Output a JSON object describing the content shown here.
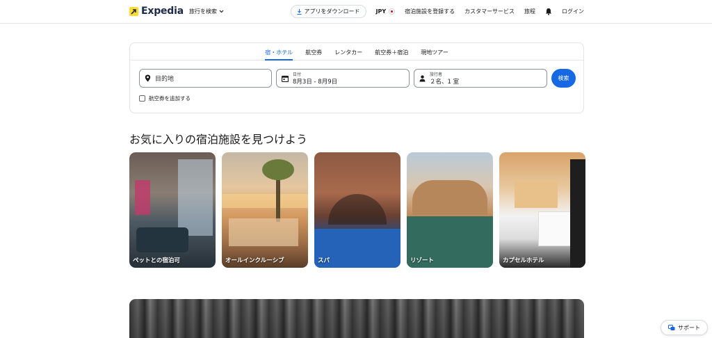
{
  "header": {
    "logo_text": "Expedia",
    "trip_search": "旅行を検索",
    "app_download": "アプリをダウンロード",
    "currency": "JPY",
    "list_property": "宿泊施設を登録する",
    "customer_service": "カスタマーサービス",
    "trips": "旅程",
    "login": "ログイン"
  },
  "search": {
    "tabs": [
      {
        "label": "宿・ホテル",
        "active": true
      },
      {
        "label": "航空券"
      },
      {
        "label": "レンタカー"
      },
      {
        "label": "航空券＋宿泊"
      },
      {
        "label": "現地ツアー"
      }
    ],
    "destination_placeholder": "目的地",
    "date_label": "日付",
    "date_value": "8月3日 - 8月9日",
    "travelers_label": "旅行者",
    "travelers_value": "２名、1 室",
    "search_button": "検索",
    "add_flight": "航空券を追加する"
  },
  "section": {
    "title": "お気に入りの宿泊施設を見つけよう",
    "cards": [
      {
        "label": "ペットとの宿泊可"
      },
      {
        "label": "オールインクルーシブ"
      },
      {
        "label": "スパ"
      },
      {
        "label": "リゾート"
      },
      {
        "label": "カプセルホテル"
      }
    ]
  },
  "support": {
    "label": "サポート"
  },
  "colors": {
    "brand_blue": "#1668e3",
    "logo_yellow": "#fddb32"
  }
}
